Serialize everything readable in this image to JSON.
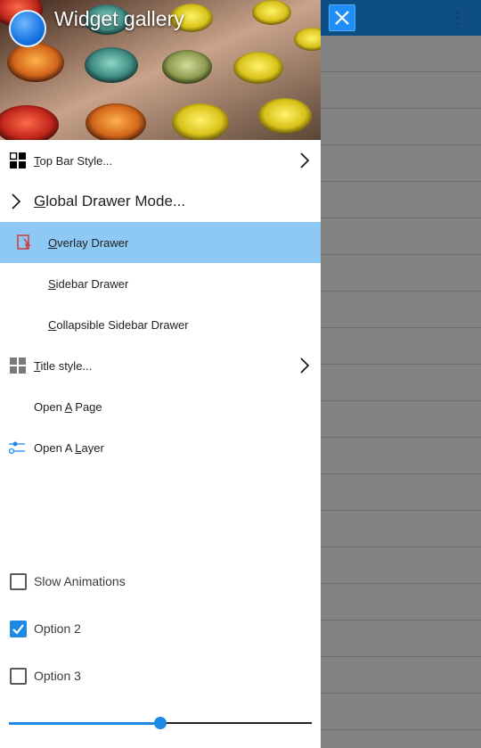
{
  "header": {
    "title": "Widget gallery"
  },
  "menu": {
    "top_bar_style": {
      "pre": "",
      "key": "T",
      "post": "op Bar Style..."
    },
    "global_drawer_mode": {
      "pre": "",
      "key": "G",
      "post": "lobal Drawer Mode..."
    },
    "overlay_drawer": {
      "pre": "",
      "key": "O",
      "post": "verlay Drawer"
    },
    "sidebar_drawer": {
      "pre": "",
      "key": "S",
      "post": "idebar Drawer"
    },
    "collapsible_sidebar_drawer": {
      "pre": "",
      "key": "C",
      "post": "ollapsible Sidebar Drawer"
    },
    "title_style": {
      "pre": "",
      "key": "T",
      "post": "itle style..."
    },
    "open_a_page": {
      "pre": "Open ",
      "key": "A",
      "post": " Page"
    },
    "open_a_layer": {
      "pre": "Open A ",
      "key": "L",
      "post": "ayer"
    }
  },
  "options": {
    "slow_animations": {
      "label": "Slow Animations",
      "checked": false
    },
    "option2": {
      "label": "Option 2",
      "checked": true
    },
    "option3": {
      "label": "Option 3",
      "checked": false
    }
  },
  "slider": {
    "value": 0.5
  },
  "colors": {
    "accent": "#1e88e5",
    "selected_row": "#8ec8f5",
    "topbar": "#1a8ef0"
  },
  "icons": {
    "close": "close-icon",
    "overflow": "more-vert-icon",
    "top_bar_style": "qr-grid-icon",
    "overlay_drawer": "overlay-drawer-icon",
    "title_style": "table-grid-icon",
    "open_a_layer": "sliders-icon",
    "chevron": "chevron-right-icon"
  }
}
